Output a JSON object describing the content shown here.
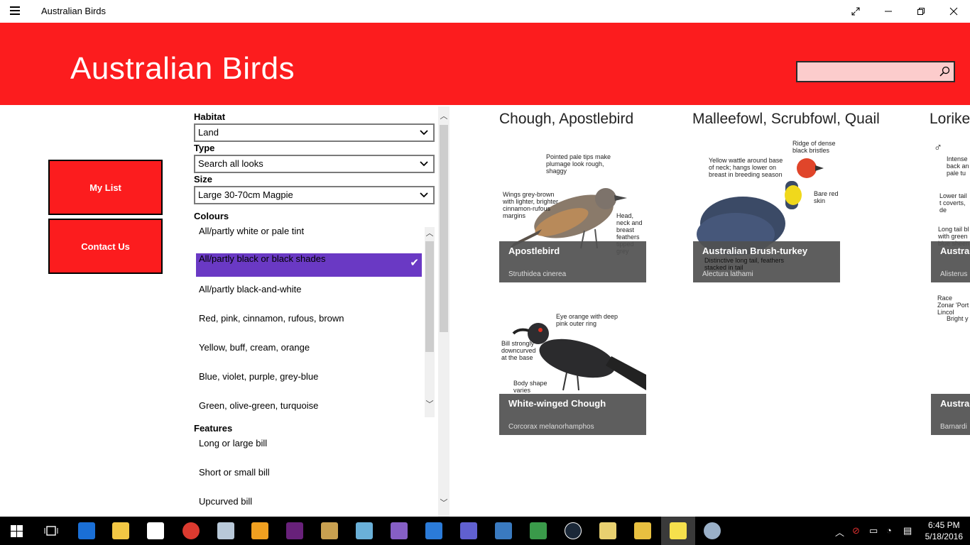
{
  "window": {
    "title": "Australian Birds"
  },
  "header": {
    "title": "Australian Birds",
    "search_placeholder": ""
  },
  "nav": {
    "my_list": "My List",
    "contact_us": "Contact Us"
  },
  "filters": {
    "habitat": {
      "label": "Habitat",
      "value": "Land"
    },
    "type": {
      "label": "Type",
      "value": "Search all looks"
    },
    "size": {
      "label": "Size",
      "value": "Large 30-70cm Magpie"
    },
    "colours": {
      "label": "Colours",
      "items": [
        "All/partly white or pale tint",
        "All/partly black or black shades",
        "All/partly black-and-white",
        "Red, pink, cinnamon, rufous, brown",
        "Yellow, buff, cream, orange",
        "Blue, violet, purple, grey-blue",
        "Green, olive-green, turquoise"
      ],
      "selected_index": 1
    },
    "features": {
      "label": "Features",
      "items": [
        "Long or large bill",
        "Short or small bill",
        "Upcurved bill"
      ]
    }
  },
  "groups": [
    {
      "title": "Chough, Apostlebird",
      "cards": [
        {
          "name": "Apostlebird",
          "scientific": "Struthidea cinerea",
          "annotations": [
            "Pointed pale tips make plumage look rough, shaggy",
            "Wings grey-brown with lighter, brighter cinnamon-rufous margins",
            "Head, neck and breast feathers tipped grey"
          ]
        },
        {
          "name": "White-winged Chough",
          "scientific": "Corcorax melanorhamphos",
          "annotations": [
            "Eye orange with deep pink outer ring",
            "Bill strongly downcurved at the base",
            "Body shape varies"
          ]
        }
      ]
    },
    {
      "title": "Malleefowl,  Scrubfowl, Quail",
      "cards": [
        {
          "name": "Australian Brush-turkey",
          "scientific": "Alectura lathami",
          "annotations": [
            "Ridge of dense black bristles",
            "Yellow wattle around base of neck; hangs lower on breast in breeding season",
            "Bare red skin",
            "Distinctive long tail, feathers stacked in tail"
          ]
        }
      ]
    },
    {
      "title": "Lorike",
      "cards": [
        {
          "name": "Austral",
          "scientific": "Alisterus",
          "annotations": [
            "♂",
            "Intense back an pale tu",
            "Lower tail t coverts, de",
            "Long tail bl with green blue sheen",
            "Race Zonar 'Port Lincol",
            "Bright y"
          ]
        },
        {
          "name": "Austral",
          "scientific": "Barnardi",
          "annotations": []
        }
      ]
    }
  ],
  "taskbar": {
    "time": "6:45 PM",
    "date": "5/18/2016",
    "icons": [
      "start-icon",
      "task-view-icon",
      "edge-icon",
      "file-explorer-icon",
      "store-icon",
      "chrome-icon",
      "remote-desktop-icon",
      "outlook-icon",
      "visual-studio-icon",
      "tools-icon",
      "notepad-icon",
      "visual-studio-2-icon",
      "visual-studio-code-icon",
      "infinity-icon",
      "app-icon",
      "excel-file-icon",
      "steam-icon",
      "folder-icon",
      "folder-2-icon",
      "birds-app-icon",
      "paint-icon"
    ]
  },
  "colors": {
    "accent_red": "#fc1c1e",
    "selection_purple": "#6a39c4"
  }
}
